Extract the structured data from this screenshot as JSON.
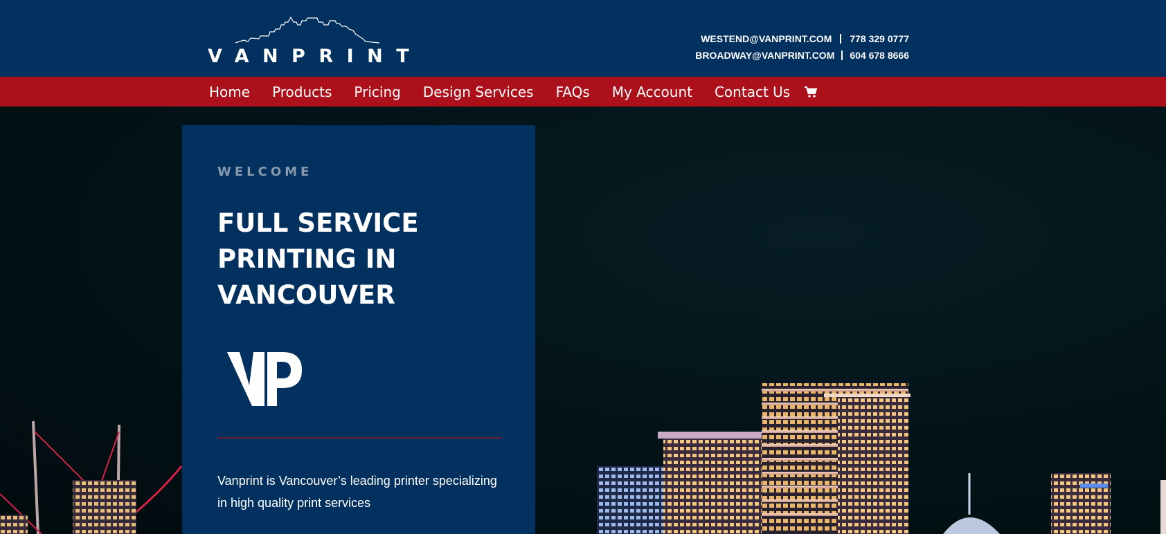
{
  "header": {
    "logo_text": "VANPRINT",
    "contacts": [
      {
        "email": "WESTEND@VANPRINT.COM",
        "phone": "778 329 0777"
      },
      {
        "email": "BROADWAY@VANPRINT.COM",
        "phone": "604 678 8666"
      }
    ]
  },
  "nav": {
    "items": [
      "Home",
      "Products",
      "Pricing",
      "Design Services",
      "FAQs",
      "My Account",
      "Contact Us"
    ],
    "cart_icon": "shopping-cart-icon"
  },
  "hero": {
    "eyebrow": "WELCOME",
    "headline": "FULL SERVICE PRINTING IN VANCOUVER",
    "logo_mark": "VP",
    "description": "Vanprint is Vancouver’s leading printer specializing in high quality print services"
  },
  "colors": {
    "header_bg": "#02305f",
    "nav_bg": "#ac111b",
    "card_bg": "#02305f",
    "hero_bg": "#021418",
    "divider": "#6b2034",
    "eyebrow": "#8a9aad"
  }
}
